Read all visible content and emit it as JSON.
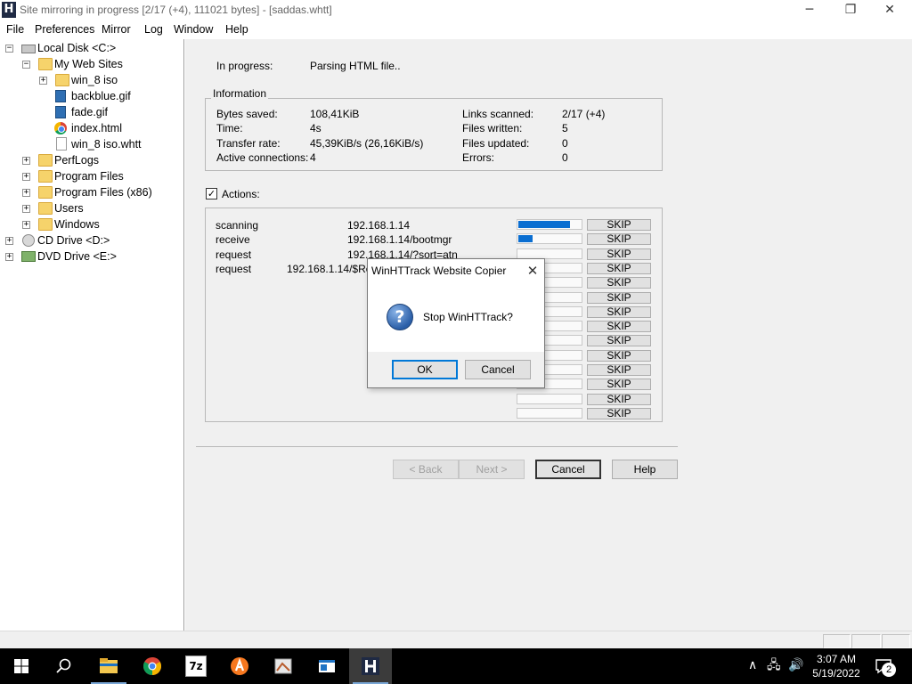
{
  "window": {
    "title": "Site mirroring in progress [2/17 (+4), 111021 bytes] - [saddas.whtt]",
    "controls": {
      "minimize": "─",
      "maximize": "❐",
      "close": "✕"
    }
  },
  "menu": [
    "File",
    "Preferences",
    "Mirror",
    "Log",
    "Window",
    "Help"
  ],
  "tree": [
    {
      "label": "Local Disk <C:>",
      "icon": "drive-icon",
      "expander": "−"
    },
    {
      "label": "My Web Sites",
      "icon": "folder-icon",
      "expander": "−"
    },
    {
      "label": "win_8 iso",
      "icon": "folder-icon",
      "expander": "+"
    },
    {
      "label": "backblue.gif",
      "icon": "image-file-icon",
      "expander": ""
    },
    {
      "label": "fade.gif",
      "icon": "image-file-icon",
      "expander": ""
    },
    {
      "label": "index.html",
      "icon": "chrome-html-icon",
      "expander": ""
    },
    {
      "label": "win_8 iso.whtt",
      "icon": "file-icon",
      "expander": ""
    },
    {
      "label": "PerfLogs",
      "icon": "folder-icon",
      "expander": "+"
    },
    {
      "label": "Program Files",
      "icon": "folder-icon",
      "expander": "+"
    },
    {
      "label": "Program Files (x86)",
      "icon": "folder-icon",
      "expander": "+"
    },
    {
      "label": "Users",
      "icon": "folder-icon",
      "expander": "+"
    },
    {
      "label": "Windows",
      "icon": "folder-icon",
      "expander": "+"
    },
    {
      "label": "CD Drive <D:>",
      "icon": "cd-drive-icon",
      "expander": "+"
    },
    {
      "label": "DVD Drive <E:>",
      "icon": "dvd-drive-icon",
      "expander": "+"
    }
  ],
  "progress": {
    "label": "In progress:",
    "value": "Parsing HTML file.."
  },
  "info": {
    "title": "Information",
    "bytes_saved_label": "Bytes saved:",
    "bytes_saved": "108,41KiB",
    "time_label": "Time:",
    "time": "4s",
    "transfer_label": "Transfer rate:",
    "transfer": "45,39KiB/s (26,16KiB/s)",
    "connections_label": "Active connections:",
    "connections": "4",
    "links_label": "Links scanned:",
    "links": "2/17 (+4)",
    "written_label": "Files written:",
    "written": "5",
    "updated_label": "Files updated:",
    "updated": "0",
    "errors_label": "Errors:",
    "errors": "0"
  },
  "actions": {
    "checkbox_mark": "✓",
    "label": "Actions:",
    "rows": [
      {
        "action": "scanning",
        "url": "192.168.1.14",
        "progress": 0.8
      },
      {
        "action": "receive",
        "url": "192.168.1.14/bootmgr",
        "progress": 0.22
      },
      {
        "action": "request",
        "url": "192.168.1.14/?sort=atn",
        "progress": 0
      },
      {
        "action": "request",
        "url": "192.168.1.14/$Rec",
        "progress": 0
      }
    ],
    "skip_label": "SKIP",
    "skip_count": 14
  },
  "wizard": {
    "back": "< Back",
    "next": "Next >",
    "cancel": "Cancel",
    "help": "Help"
  },
  "dialog": {
    "title": "WinHTTrack Website Copier",
    "close": "✕",
    "icon": "?",
    "message": "Stop WinHTTrack?",
    "ok": "OK",
    "cancel": "Cancel"
  },
  "taskbar": {
    "apps": [
      "start-icon",
      "search-icon",
      "file-explorer-icon",
      "chrome-icon",
      "7zip-icon",
      "avast-icon",
      "app-icon",
      "app-window-icon",
      "winhttrack-icon"
    ],
    "sevenzip_text": "7z",
    "tray": {
      "chevron": "∧",
      "network": "🖧",
      "volume": "🔊"
    },
    "time": "3:07 AM",
    "date": "5/19/2022",
    "notifications": "2"
  }
}
